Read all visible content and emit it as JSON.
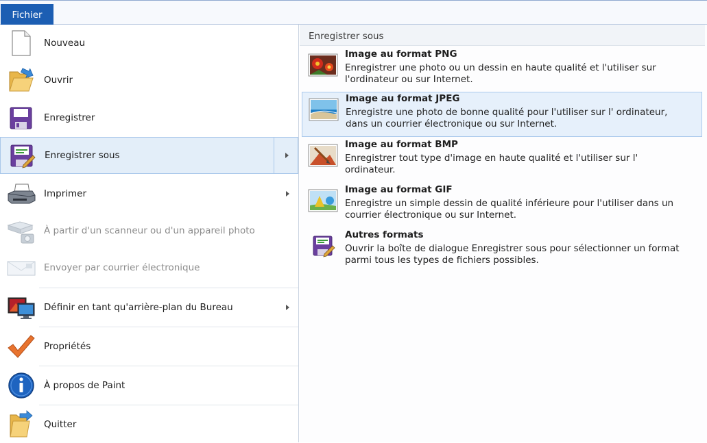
{
  "top_bar": {
    "tab_label": "Fichier"
  },
  "menu": {
    "items": [
      {
        "label": "Nouveau",
        "icon": "blank-page-icon",
        "enabled": true,
        "submenu": false,
        "selected": false
      },
      {
        "label": "Ouvrir",
        "icon": "open-folder-icon",
        "enabled": true,
        "submenu": false,
        "selected": false
      },
      {
        "label": "Enregistrer",
        "icon": "floppy-disk-icon",
        "enabled": true,
        "submenu": false,
        "selected": false
      },
      {
        "label": "Enregistrer sous",
        "icon": "save-as-icon",
        "enabled": true,
        "submenu": true,
        "selected": true
      },
      {
        "label": "Imprimer",
        "icon": "printer-icon",
        "enabled": true,
        "submenu": true,
        "selected": false
      },
      {
        "label": "À partir d'un scanneur ou d'un appareil photo",
        "icon": "scanner-icon",
        "enabled": false,
        "submenu": false,
        "selected": false
      },
      {
        "label": "Envoyer par courrier électronique",
        "icon": "email-icon",
        "enabled": false,
        "submenu": false,
        "selected": false
      },
      {
        "label": "Définir en tant qu'arrière-plan du Bureau",
        "icon": "desktop-background-icon",
        "enabled": true,
        "submenu": true,
        "selected": false
      },
      {
        "label": "Propriétés",
        "icon": "checkmark-icon",
        "enabled": true,
        "submenu": false,
        "selected": false
      },
      {
        "label": "À propos de Paint",
        "icon": "info-icon",
        "enabled": true,
        "submenu": false,
        "selected": false
      },
      {
        "label": "Quitter",
        "icon": "exit-icon",
        "enabled": true,
        "submenu": false,
        "selected": false
      }
    ]
  },
  "submenu": {
    "title": "Enregistrer sous",
    "formats": [
      {
        "title": "Image au format PNG",
        "description": "Enregistrer une photo ou un dessin en haute qualité et l'utiliser sur l'ordinateur ou sur Internet.",
        "icon": "png-image-icon",
        "highlighted": false
      },
      {
        "title": "Image au format JPEG",
        "description": "Enregistre une photo de bonne qualité pour l'utiliser sur l' ordinateur, dans un courrier électronique ou sur Internet.",
        "icon": "jpeg-image-icon",
        "highlighted": true
      },
      {
        "title": "Image au format BMP",
        "description": "Enregistrer tout type d'image en haute qualité et l'utiliser sur l' ordinateur.",
        "icon": "bmp-image-icon",
        "highlighted": false
      },
      {
        "title": "Image au format GIF",
        "description": "Enregistre un simple dessin de qualité inférieure pour l'utiliser dans un courrier électronique ou sur Internet.",
        "icon": "gif-image-icon",
        "highlighted": false
      },
      {
        "title": "Autres formats",
        "description": "Ouvrir la boîte de dialogue Enregistrer sous pour sélectionner un format parmi tous les types de fichiers possibles.",
        "icon": "other-formats-icon",
        "highlighted": false
      }
    ]
  },
  "colors": {
    "tab_blue": "#1c5eb3",
    "selection_bg": "#e3eef9",
    "selection_border": "#a8c7ea",
    "disabled_text": "#8c8c8c"
  }
}
